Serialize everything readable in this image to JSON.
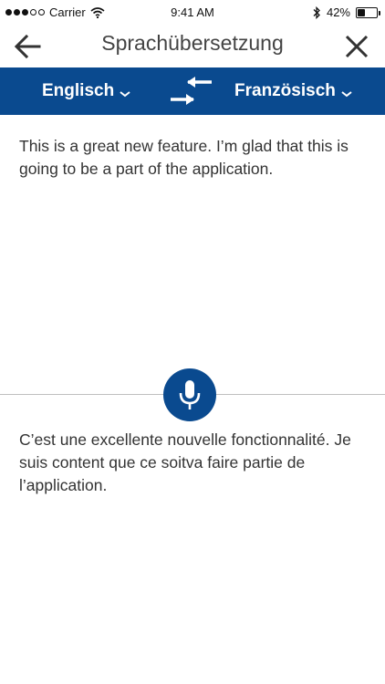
{
  "status_bar": {
    "carrier": "Carrier",
    "time": "9:41 AM",
    "battery_percent": "42%",
    "battery_level": 0.42,
    "signal_bars_filled": 3,
    "signal_bars_total": 5,
    "icons": [
      "wifi-icon",
      "bluetooth-icon",
      "battery-icon"
    ]
  },
  "nav": {
    "title": "Sprachübersetzung",
    "back_icon": "arrow-left-icon",
    "close_icon": "close-icon"
  },
  "languages": {
    "source": "Englisch",
    "target": "Französisch",
    "swap_icon": "swap-arrows-icon",
    "dropdown_icon": "chevron-down-icon"
  },
  "translation": {
    "source_text": "This is a great new feature. I’m glad that this is going to be a part of the application.",
    "target_text": "C’est une excellente nouvelle fonctionnalité. Je suis content que ce soitva faire partie de l’application.",
    "mic_icon": "microphone-icon"
  },
  "colors": {
    "brand_blue": "#0a4a8f",
    "divider": "#bfbfbf",
    "text": "#333333"
  }
}
